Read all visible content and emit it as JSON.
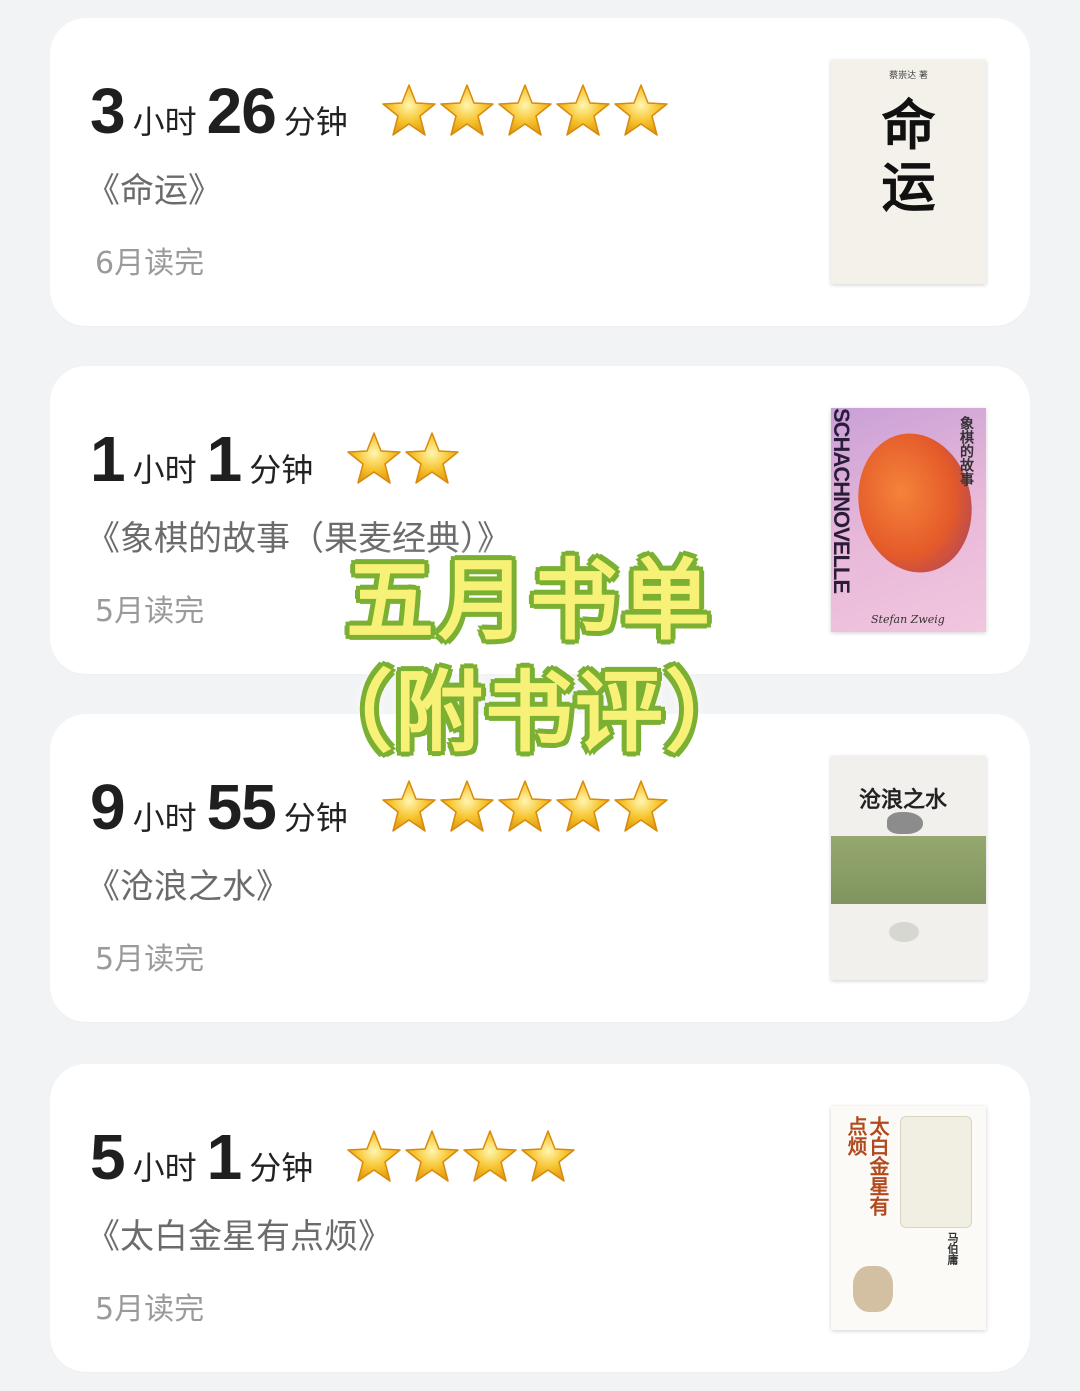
{
  "overlay": {
    "line1": "五月书单",
    "line2": "（附书评）"
  },
  "books": [
    {
      "hours": "3",
      "hours_unit": "小时",
      "minutes": "26",
      "minutes_unit": "分钟",
      "stars": 5,
      "title": "《命运》",
      "finished": "6月读完",
      "cover": {
        "title": "命\n运",
        "author": "蔡崇达 著"
      }
    },
    {
      "hours": "1",
      "hours_unit": "小时",
      "minutes": "1",
      "minutes_unit": "分钟",
      "stars": 2,
      "title": "《象棋的故事（果麦经典）》",
      "finished": "5月读完",
      "cover": {
        "vertical": "SCHACHNOVELLE",
        "title": "象棋的故事",
        "signature": "Stefan Zweig"
      }
    },
    {
      "hours": "9",
      "hours_unit": "小时",
      "minutes": "55",
      "minutes_unit": "分钟",
      "stars": 5,
      "title": "《沧浪之水》",
      "finished": "5月读完",
      "cover": {
        "title": "沧浪之水"
      }
    },
    {
      "hours": "5",
      "hours_unit": "小时",
      "minutes": "1",
      "minutes_unit": "分钟",
      "stars": 4,
      "title": "《太白金星有点烦》",
      "finished": "5月读完",
      "cover": {
        "title": "太白金星有点烦",
        "author": "马伯庸"
      }
    }
  ],
  "colors": {
    "background": "#f2f3f5",
    "card": "#ffffff",
    "overlay_text": "#f7f178",
    "overlay_outline": "#7bb032",
    "star": "#f7c531"
  }
}
